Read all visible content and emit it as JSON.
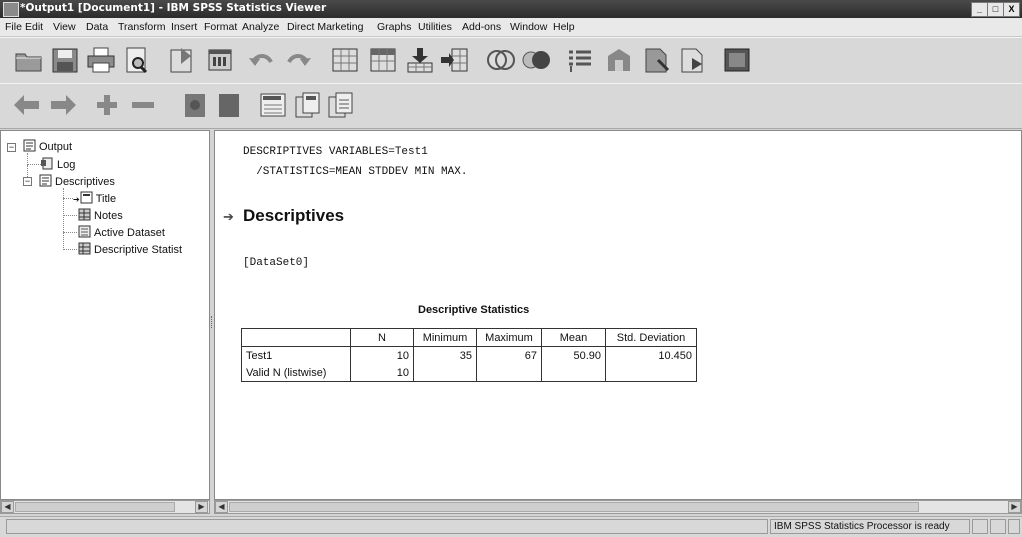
{
  "window": {
    "title": "*Output1 [Document1] - IBM SPSS Statistics Viewer",
    "buttons": [
      "_",
      "□",
      "X"
    ]
  },
  "menu": [
    "File",
    "Edit",
    "View",
    "Data",
    "Transform",
    "Insert",
    "Format",
    "Analyze",
    "Direct Marketing",
    "Graphs",
    "Utilities",
    "Add-ons",
    "Window",
    "Help"
  ],
  "toolbar1_icons": [
    "open-icon",
    "save-icon",
    "print-icon",
    "print-preview-icon",
    "export-icon",
    "recall-dialog-icon",
    "undo-icon",
    "redo-icon",
    "goto-case-icon",
    "goto-variable-icon",
    "insert-cases-icon",
    "insert-variable-icon",
    "split-file-icon",
    "weight-cases-icon",
    "select-cases-icon",
    "designate-window-icon",
    "create-output-icon",
    "run-script-icon",
    "toggle-icon"
  ],
  "toolbar2_icons": [
    "back-arrow-icon",
    "forward-arrow-icon",
    "expand-icon",
    "collapse-icon",
    "show-icon",
    "hide-icon",
    "insert-heading-icon",
    "insert-title-icon",
    "insert-text-icon"
  ],
  "outline": {
    "root": "Output",
    "log": "Log",
    "descriptives": "Descriptives",
    "title": "Title",
    "notes": "Notes",
    "active_dataset": "Active Dataset",
    "descriptive_statistics": "Descriptive Statist"
  },
  "content": {
    "syntax_line1": "DESCRIPTIVES VARIABLES=Test1",
    "syntax_line2": "  /STATISTICS=MEAN STDDEV MIN MAX.",
    "heading": "Descriptives",
    "dataset": "[DataSet0]",
    "table_title": "Descriptive Statistics",
    "table": {
      "headers": [
        "",
        "N",
        "Minimum",
        "Maximum",
        "Mean",
        "Std. Deviation"
      ],
      "rows": [
        [
          "Test1",
          "10",
          "35",
          "67",
          "50.90",
          "10.450"
        ],
        [
          "Valid N (listwise)",
          "10",
          "",
          "",
          "",
          ""
        ]
      ]
    }
  },
  "status": {
    "message": "IBM SPSS Statistics Processor is ready"
  }
}
